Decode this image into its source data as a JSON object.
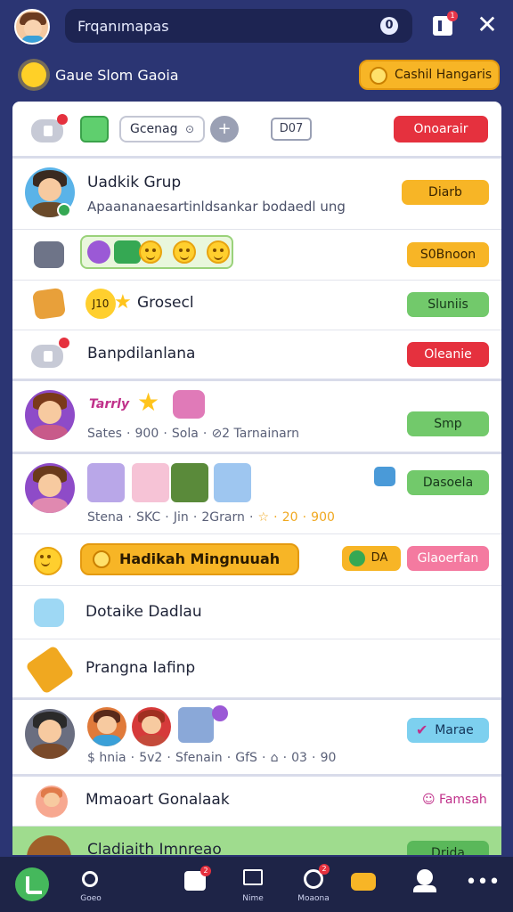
{
  "header": {
    "search_value": "Frqanımapas",
    "search_badge": "0",
    "notification_count": "1"
  },
  "subheader": {
    "title": "Gaue Slom Gaoia",
    "action_label": "Cashil Hangaris"
  },
  "row1": {
    "filter_label": "Gcenag",
    "count_label": "D07",
    "action_label": "Onoarair"
  },
  "row2": {
    "name": "Uadkik Grup",
    "subtitle": "Apaananaesartinldsankar bodaedl ung",
    "action_label": "Diarb"
  },
  "row3": {
    "action_label": "S0Bnoon"
  },
  "row4": {
    "badge_label": "J10",
    "name": "Grosecl",
    "action_label": "Sluniis"
  },
  "row5": {
    "name": "Banpdilanlana",
    "action_label": "Oleanie"
  },
  "row6": {
    "banner_label": "Tarrly",
    "meta": [
      "Sates",
      "·",
      "900",
      "·",
      "Sola",
      "·",
      "⊘2 Tarnainarn"
    ],
    "action_label": "Smp"
  },
  "row7": {
    "meta": [
      "Stena",
      "·",
      "SKC",
      "·",
      "Jin",
      "·",
      "2Grarn",
      "·",
      "☆",
      "·",
      "20",
      "·",
      "900"
    ],
    "action_label": "Dasoela"
  },
  "row8": {
    "highlight_label": "Hadikah Mingnuuah",
    "small_label": "DA",
    "action_label": "Glaoerfan"
  },
  "row9": {
    "name": "Dotaike Dadlau"
  },
  "row10": {
    "name": "Prangna Iafinp"
  },
  "row11": {
    "meta": [
      "$ hnia",
      "·",
      "5v2",
      "·",
      "Sfenain",
      "·",
      "GfS",
      "·",
      "⌂",
      "·",
      "03",
      "·",
      "90"
    ],
    "action_label": "Marae"
  },
  "row12": {
    "name": "Mmaoart Gonalaak",
    "action_label": "Famsah"
  },
  "row13": {
    "name": "Cladiaith Imnreao",
    "action_label": "Drida"
  },
  "nav": {
    "items": [
      {
        "label": ""
      },
      {
        "label": "Goeo"
      },
      {
        "label": ""
      },
      {
        "label": "Nime"
      },
      {
        "label": "Moaona"
      },
      {
        "label": ""
      },
      {
        "label": ""
      },
      {
        "label": ""
      }
    ],
    "badges": [
      "2",
      "2"
    ]
  },
  "colors": {
    "background": "#2b3573",
    "panel": "#ffffff",
    "red": "#e5313e",
    "orange": "#f7b526",
    "green": "#72c96b",
    "pink": "#f47aa0",
    "blue": "#7dd0ef"
  }
}
